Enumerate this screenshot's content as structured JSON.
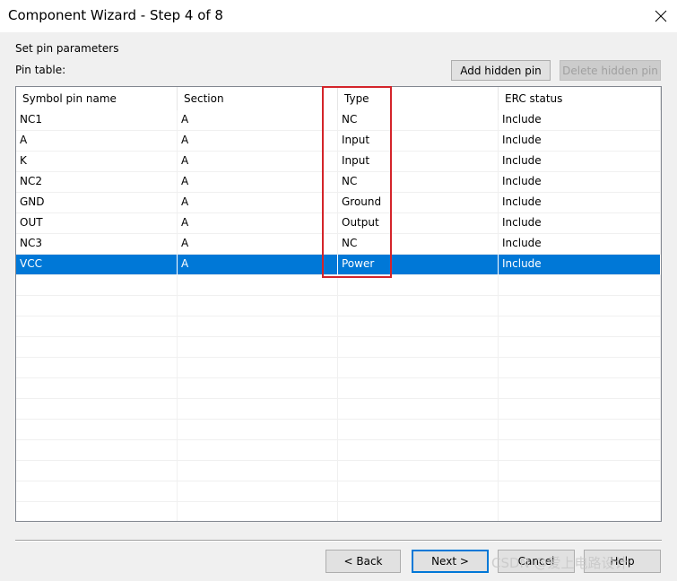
{
  "window": {
    "title": "Component Wizard - Step 4 of 8"
  },
  "step": {
    "heading": "Set pin parameters",
    "table_label": "Pin table:"
  },
  "actions": {
    "add_hidden_pin": "Add hidden pin",
    "delete_hidden_pin": "Delete hidden pin"
  },
  "table": {
    "columns": [
      "Symbol pin name",
      "Section",
      "Type",
      "ERC status"
    ],
    "rows": [
      [
        "NC1",
        "A",
        "NC",
        "Include"
      ],
      [
        "A",
        "A",
        "Input",
        "Include"
      ],
      [
        "K",
        "A",
        "Input",
        "Include"
      ],
      [
        "NC2",
        "A",
        "NC",
        "Include"
      ],
      [
        "GND",
        "A",
        "Ground",
        "Include"
      ],
      [
        "OUT",
        "A",
        "Output",
        "Include"
      ],
      [
        "NC3",
        "A",
        "NC",
        "Include"
      ],
      [
        "VCC",
        "A",
        "Power",
        "Include"
      ]
    ],
    "selected_row_index": 7
  },
  "footer": {
    "back": "< Back",
    "next": "Next >",
    "cancel": "Cancel",
    "help": "Help"
  },
  "watermark": "CSDN @爱上电路设计",
  "colors": {
    "selection": "#0078d7",
    "highlight_box": "#d4242a"
  }
}
